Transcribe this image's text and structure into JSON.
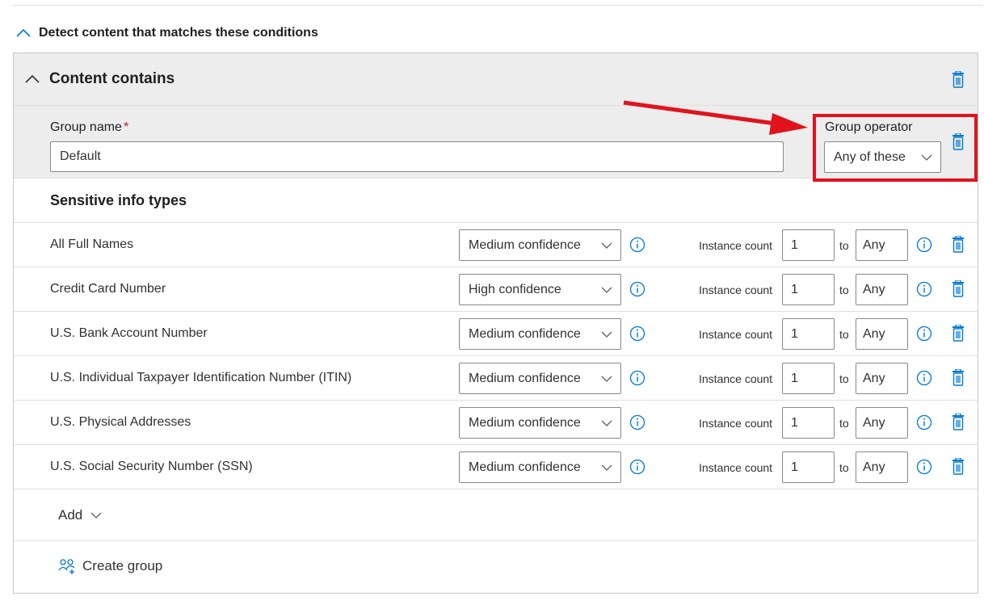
{
  "section": {
    "title": "Detect content that matches these conditions"
  },
  "content_contains": {
    "title": "Content contains"
  },
  "group": {
    "name_label": "Group name",
    "required_mark": "*",
    "name_value": "Default",
    "operator_label": "Group operator",
    "operator_value": "Any of these"
  },
  "sensitive_info": {
    "header": "Sensitive info types",
    "instance_label": "Instance count",
    "to_label": "to",
    "rows": [
      {
        "name": "All Full Names",
        "confidence": "Medium confidence",
        "min": "1",
        "max": "Any"
      },
      {
        "name": "Credit Card Number",
        "confidence": "High confidence",
        "min": "1",
        "max": "Any"
      },
      {
        "name": "U.S. Bank Account Number",
        "confidence": "Medium confidence",
        "min": "1",
        "max": "Any"
      },
      {
        "name": "U.S. Individual Taxpayer Identification Number (ITIN)",
        "confidence": "Medium confidence",
        "min": "1",
        "max": "Any"
      },
      {
        "name": "U.S. Physical Addresses",
        "confidence": "Medium confidence",
        "min": "1",
        "max": "Any"
      },
      {
        "name": "U.S. Social Security Number (SSN)",
        "confidence": "Medium confidence",
        "min": "1",
        "max": "Any"
      }
    ]
  },
  "actions": {
    "add_label": "Add",
    "create_group_label": "Create group"
  },
  "icons": {
    "collapse": "chevron-up-icon",
    "delete": "trash-icon",
    "info": "info-icon",
    "dropdown": "chevron-down-icon",
    "group": "people-add-icon"
  },
  "colors": {
    "accent": "#0078d4",
    "highlight": "#e0131d",
    "required": "#a4262c",
    "header_bg": "#ededed"
  }
}
